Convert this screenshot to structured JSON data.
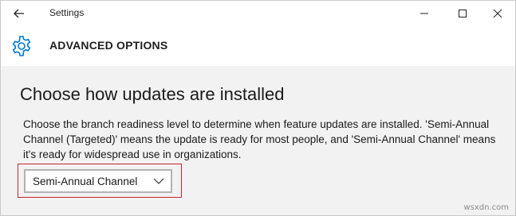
{
  "window": {
    "title": "Settings",
    "controls": [
      "minimize-icon",
      "maximize-icon",
      "close-icon"
    ]
  },
  "header": {
    "icon": "gear-icon",
    "title": "ADVANCED OPTIONS"
  },
  "section": {
    "heading": "Choose how updates are installed",
    "description": "Choose the branch readiness level to determine when feature updates are installed. 'Semi-Annual Channel (Targeted)' means the update is ready for most people, and 'Semi-Annual Channel' means it's ready for widespread use in organizations.",
    "dropdown": {
      "selected": "Semi-Annual Channel",
      "icon": "chevron-down-icon"
    }
  },
  "watermark": "wsxdn.com",
  "colors": {
    "accent": "#0078d7",
    "highlight_border": "#c7252b",
    "content_bg": "#f2f2f2"
  }
}
